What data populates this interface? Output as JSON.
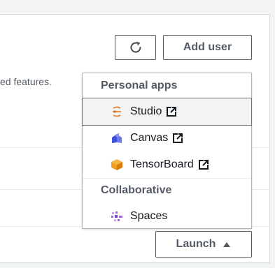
{
  "toolbar": {
    "refresh_icon": "refresh-icon",
    "add_user_label": "Add user"
  },
  "description": {
    "text": "ed features."
  },
  "launch": {
    "label": "Launch",
    "icon": "caret-up-icon"
  },
  "dropdown": {
    "groups": [
      {
        "header": "Personal apps",
        "items": [
          {
            "label": "Studio",
            "icon": "studio-icon",
            "external": true,
            "selected": true
          },
          {
            "label": "Canvas",
            "icon": "canvas-icon",
            "external": true,
            "selected": false
          },
          {
            "label": "TensorBoard",
            "icon": "tensorboard-icon",
            "external": true,
            "selected": false
          }
        ]
      },
      {
        "header": "Collaborative",
        "items": [
          {
            "label": "Spaces",
            "icon": "spaces-icon",
            "external": false,
            "selected": false
          }
        ]
      }
    ]
  },
  "colors": {
    "border_dark": "#545b64",
    "studio_orange": "#e8843a",
    "canvas_blue": "#4b5de6",
    "tensorboard_orange": "#f29c1f",
    "spaces_purple": "#9b6bd6"
  }
}
